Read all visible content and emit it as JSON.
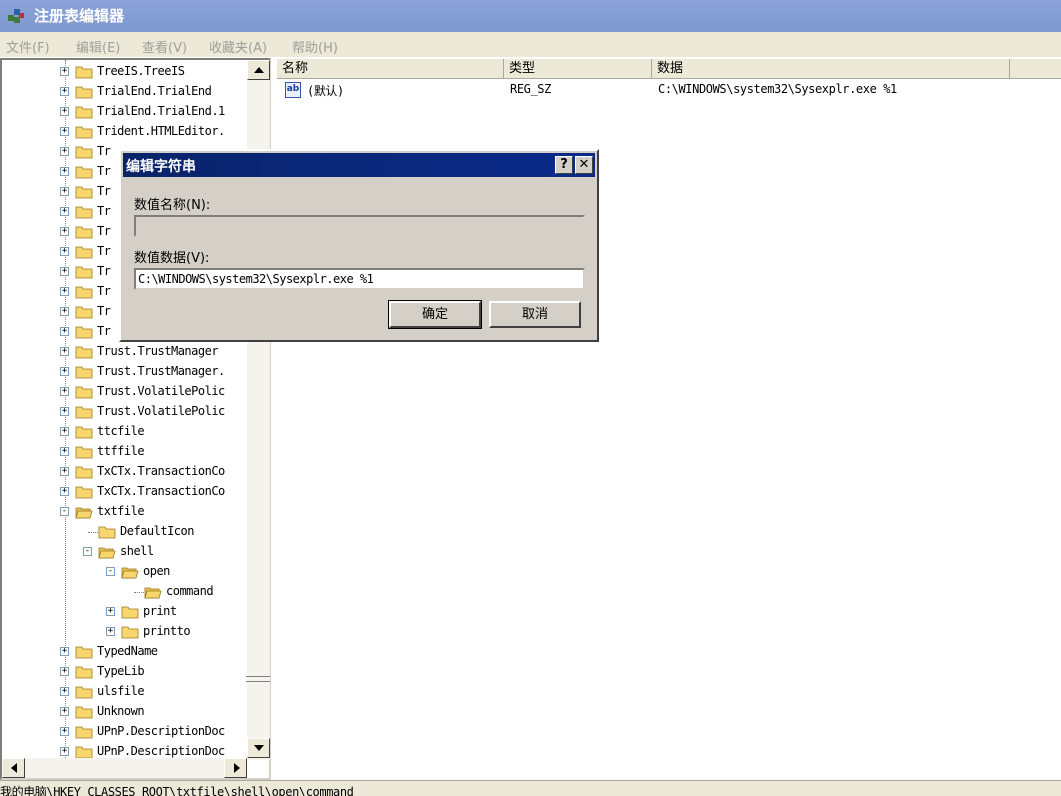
{
  "window": {
    "title": "注册表编辑器"
  },
  "menu": [
    "文件(F)",
    "编辑(E)",
    "查看(V)",
    "收藏夹(A)",
    "帮助(H)"
  ],
  "tree": [
    {
      "label": "TreeIS.TreeIS",
      "level": 0,
      "toggle": "+"
    },
    {
      "label": "TrialEnd.TrialEnd",
      "level": 0,
      "toggle": "+"
    },
    {
      "label": "TrialEnd.TrialEnd.1",
      "level": 0,
      "toggle": "+"
    },
    {
      "label": "Trident.HTMLEditor.",
      "level": 0,
      "toggle": "+"
    },
    {
      "label": "Tr",
      "level": 0,
      "toggle": "+"
    },
    {
      "label": "Tr",
      "level": 0,
      "toggle": "+"
    },
    {
      "label": "Tr",
      "level": 0,
      "toggle": "+"
    },
    {
      "label": "Tr",
      "level": 0,
      "toggle": "+"
    },
    {
      "label": "Tr",
      "level": 0,
      "toggle": "+"
    },
    {
      "label": "Tr",
      "level": 0,
      "toggle": "+"
    },
    {
      "label": "Tr",
      "level": 0,
      "toggle": "+"
    },
    {
      "label": "Tr",
      "level": 0,
      "toggle": "+"
    },
    {
      "label": "Tr",
      "level": 0,
      "toggle": "+"
    },
    {
      "label": "Tr",
      "level": 0,
      "toggle": "+"
    },
    {
      "label": "Trust.TrustManager",
      "level": 0,
      "toggle": "+"
    },
    {
      "label": "Trust.TrustManager.",
      "level": 0,
      "toggle": "+"
    },
    {
      "label": "Trust.VolatilePolic",
      "level": 0,
      "toggle": "+"
    },
    {
      "label": "Trust.VolatilePolic",
      "level": 0,
      "toggle": "+"
    },
    {
      "label": "ttcfile",
      "level": 0,
      "toggle": "+"
    },
    {
      "label": "ttffile",
      "level": 0,
      "toggle": "+"
    },
    {
      "label": "TxCTx.TransactionCo",
      "level": 0,
      "toggle": "+"
    },
    {
      "label": "TxCTx.TransactionCo",
      "level": 0,
      "toggle": "+"
    },
    {
      "label": "txtfile",
      "level": 0,
      "toggle": "-"
    },
    {
      "label": "DefaultIcon",
      "level": 1,
      "toggle": ""
    },
    {
      "label": "shell",
      "level": 1,
      "toggle": "-"
    },
    {
      "label": "open",
      "level": 2,
      "toggle": "-"
    },
    {
      "label": "command",
      "level": 3,
      "toggle": "",
      "selected": true
    },
    {
      "label": "print",
      "level": 2,
      "toggle": "+"
    },
    {
      "label": "printto",
      "level": 2,
      "toggle": "+"
    },
    {
      "label": "TypedName",
      "level": 0,
      "toggle": "+"
    },
    {
      "label": "TypeLib",
      "level": 0,
      "toggle": "+"
    },
    {
      "label": "ulsfile",
      "level": 0,
      "toggle": "+"
    },
    {
      "label": "Unknown",
      "level": 0,
      "toggle": "+"
    },
    {
      "label": "UPnP.DescriptionDoc",
      "level": 0,
      "toggle": "+"
    },
    {
      "label": "UPnP.DescriptionDoc",
      "level": 0,
      "toggle": "+"
    }
  ],
  "list": {
    "headers": {
      "name": "名称",
      "type": "类型",
      "data": "数据"
    },
    "rows": [
      {
        "icon": "string-value-icon",
        "icon_text": "ab",
        "name": "(默认)",
        "type": "REG_SZ",
        "data": "C:\\WINDOWS\\system32\\Sysexplr.exe %1"
      }
    ]
  },
  "dialog": {
    "title": "编辑字符串",
    "help_label": "?",
    "close_label": "✕",
    "name_label": "数值名称(N):",
    "name_value": "",
    "data_label": "数值数据(V):",
    "data_value": "C:\\WINDOWS\\system32\\Sysexplr.exe %1",
    "ok_label": "确定",
    "cancel_label": "取消"
  },
  "status": {
    "path": "我的电脑\\HKEY_CLASSES_ROOT\\txtfile\\shell\\open\\command"
  },
  "colors": {
    "titlebar": "#7f98d0",
    "dialog_title": "#0a246a",
    "folder": "#f7d66e"
  }
}
